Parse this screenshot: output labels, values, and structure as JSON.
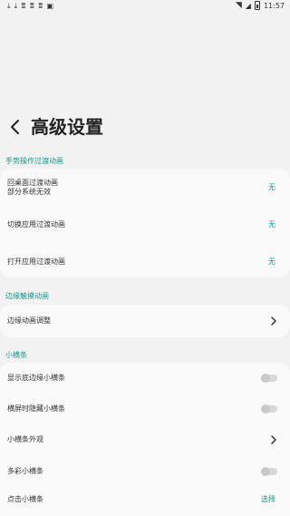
{
  "status_bar": {
    "left_icons": [
      "download-icon",
      "download-icon",
      "bug-icon",
      "bug-icon",
      "bug-icon",
      "app-icon"
    ],
    "time": "11:57"
  },
  "header": {
    "back_icon": "back-arrow-icon",
    "title": "高级设置"
  },
  "sections": {
    "gesture": {
      "label": "手势操作过渡动画",
      "rows": [
        {
          "label_line1": "回桌面过渡动画",
          "label_line2": "部分系统无效",
          "value": "无"
        },
        {
          "label": "切换应用过渡动画",
          "value": "无"
        },
        {
          "label": "打开应用过渡动画",
          "value": "无"
        }
      ]
    },
    "edge": {
      "label": "边缘触摸动画",
      "rows": [
        {
          "label": "边缘动画调整",
          "control": "chevron"
        }
      ]
    },
    "bar": {
      "label": "小横条",
      "rows": [
        {
          "label": "显示底边缘小横条",
          "control": "toggle",
          "enabled": false
        },
        {
          "label": "横屏时隐藏小横条",
          "control": "toggle",
          "enabled": false
        },
        {
          "label": "小横条外观",
          "control": "chevron"
        },
        {
          "label": "多彩小横条",
          "control": "toggle",
          "enabled": false
        },
        {
          "label": "点击小横条",
          "value": "选择"
        }
      ]
    }
  },
  "colors": {
    "accent": "#139a8c",
    "background": "#f2f2f2",
    "card": "#fafafa"
  }
}
